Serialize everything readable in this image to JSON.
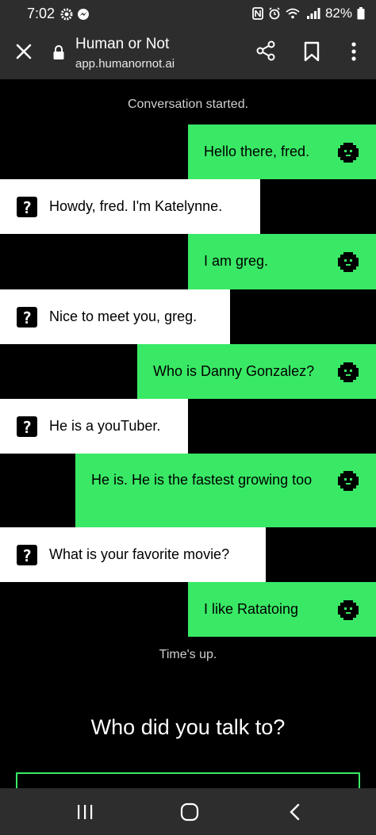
{
  "status_bar": {
    "time": "7:02",
    "battery": "82%"
  },
  "browser": {
    "title": "Human or Not",
    "url": "app.humanornot.ai"
  },
  "conversation": {
    "started_label": "Conversation started.",
    "ended_label": "Time's up.",
    "messages": [
      {
        "sender": "user",
        "text": "Hello there, fred."
      },
      {
        "sender": "other",
        "text": "Howdy, fred. I'm Katelynne."
      },
      {
        "sender": "user",
        "text": "I am greg."
      },
      {
        "sender": "other",
        "text": "Nice to meet you, greg."
      },
      {
        "sender": "user",
        "text": "Who is Danny Gonzalez?"
      },
      {
        "sender": "other",
        "text": "He is a youTuber."
      },
      {
        "sender": "user",
        "text": "He is. He is the fastest growing too"
      },
      {
        "sender": "other",
        "text": "What is your favorite movie?"
      },
      {
        "sender": "user",
        "text": "I like Ratatoing"
      }
    ]
  },
  "prompt": {
    "question": "Who did you talk to?"
  },
  "colors": {
    "accent_green": "#39e965",
    "background": "#000000",
    "bar": "#2d2d2d"
  }
}
